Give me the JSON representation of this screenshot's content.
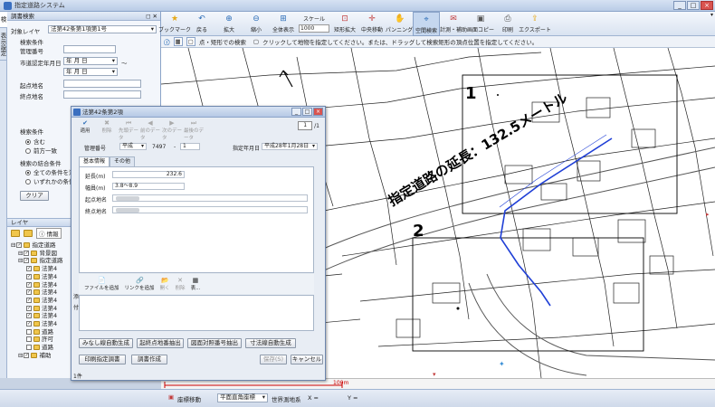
{
  "window": {
    "title": "指定道路システム",
    "controls": [
      "_",
      "□",
      "×"
    ]
  },
  "side_tabs": [
    "検索",
    "表示設定"
  ],
  "search_panel": {
    "header": "調書検索",
    "target_layer_label": "対象レイヤ",
    "target_layer_value": "法第42条第1項第1号",
    "search_conditions_label": "検索条件",
    "admin_no_label": "管理番号",
    "designation_date_label": "市道認定年月日",
    "year_month_day": "年 月 日",
    "range_separator": "～",
    "start_label": "起点地名",
    "end_label": "終点地名",
    "search_condition_group": "検索条件",
    "radio_includes": "含む",
    "radio_prefix": "前方一致",
    "combine_label": "検索の結合条件",
    "radio_all": "全ての条件を満たす",
    "radio_any": "いずれかの条件を満たす",
    "clear_button": "クリア"
  },
  "layer_panel": {
    "header": "レイヤ",
    "info_label": "情報",
    "tree": [
      {
        "label": "指定道路",
        "checked": true,
        "level": 0
      },
      {
        "label": "背景図",
        "checked": true,
        "level": 1
      },
      {
        "label": "指定道路",
        "checked": true,
        "level": 1
      },
      {
        "label": "法第4",
        "checked": true,
        "level": 2
      },
      {
        "label": "法第4",
        "checked": true,
        "level": 2
      },
      {
        "label": "法第4",
        "checked": true,
        "level": 2
      },
      {
        "label": "法第4",
        "checked": true,
        "level": 2
      },
      {
        "label": "法第4",
        "checked": true,
        "level": 2
      },
      {
        "label": "法第4",
        "checked": true,
        "level": 2
      },
      {
        "label": "法第4",
        "checked": true,
        "level": 2
      },
      {
        "label": "法第4",
        "checked": true,
        "level": 2
      },
      {
        "label": "道路",
        "checked": false,
        "level": 2
      },
      {
        "label": "許可",
        "checked": false,
        "level": 2
      },
      {
        "label": "道路",
        "checked": false,
        "level": 2
      },
      {
        "label": "補助",
        "checked": true,
        "level": 1
      }
    ]
  },
  "toolbar": {
    "items": [
      {
        "label": "ブックマーク",
        "icon": "star-icon",
        "glyph": "★",
        "color": "#e6a817"
      },
      {
        "label": "戻る",
        "icon": "undo-icon",
        "glyph": "↶",
        "color": "#2f6fb8"
      },
      {
        "label": "拡大",
        "icon": "zoom-in-icon",
        "glyph": "⊕",
        "color": "#2f6fb8"
      },
      {
        "label": "縮小",
        "icon": "zoom-out-icon",
        "glyph": "⊖",
        "color": "#2f6fb8"
      },
      {
        "label": "全体表示",
        "icon": "fit-icon",
        "glyph": "⊞",
        "color": "#2f6fb8"
      }
    ],
    "scale_label": "スケール",
    "scale_value": "1000",
    "items2": [
      {
        "label": "矩形拡大",
        "icon": "rect-zoom-icon",
        "glyph": "⊡",
        "color": "#c23b3b"
      },
      {
        "label": "中央移動",
        "icon": "center-move-icon",
        "glyph": "✛",
        "color": "#c23b3b"
      },
      {
        "label": "パンニング",
        "icon": "pan-icon",
        "glyph": "✋",
        "color": "#555555"
      },
      {
        "label": "空間検索",
        "icon": "spatial-search-icon",
        "glyph": "⌖",
        "color": "#2f6fb8",
        "selected": true
      },
      {
        "label": "計測・補助",
        "icon": "measure-icon",
        "glyph": "✉",
        "color": "#c23b3b"
      },
      {
        "label": "画面コピー",
        "icon": "screen-copy-icon",
        "glyph": "▣",
        "color": "#555555"
      },
      {
        "label": "印刷",
        "icon": "print-icon",
        "glyph": "⎙",
        "color": "#555555"
      },
      {
        "label": "エクスポート",
        "icon": "export-icon",
        "glyph": "⇪",
        "color": "#e6a817"
      }
    ]
  },
  "infobar": {
    "mode": "点・矩形での検索",
    "message": "クリックして地物を指定してください。または、ドラッグして検索矩形の頂点位置を指定してください。"
  },
  "map": {
    "label_1": "1",
    "label_2": "2",
    "road_length_label": "指定道路の延長：132.5メートル",
    "scale_text": "100m"
  },
  "dialog": {
    "title": "法第42条第2項",
    "controls": [
      "_",
      "□",
      "×"
    ],
    "tools": [
      {
        "label": "適用",
        "icon": "apply-icon",
        "glyph": "✔",
        "enabled": true
      },
      {
        "label": "削除",
        "icon": "delete-icon",
        "glyph": "✖",
        "enabled": false
      },
      {
        "label": "先頭データ",
        "icon": "first-icon",
        "glyph": "⏮",
        "enabled": false
      },
      {
        "label": "前のデータ",
        "icon": "prev-icon",
        "glyph": "◀",
        "enabled": false
      },
      {
        "label": "次のデータ",
        "icon": "next-icon",
        "glyph": "▶",
        "enabled": false
      },
      {
        "label": "最後のデータ",
        "icon": "last-icon",
        "glyph": "⏭",
        "enabled": false
      }
    ],
    "page_current": "1",
    "page_total": "/1",
    "admin_no_label": "管理番号",
    "era_value": "平成",
    "admin_no_value": "7497",
    "dash": "-",
    "admin_no_suffix": "1",
    "designation_date_label": "指定年月日",
    "designation_date_value": "平成28年1月28日",
    "tabs": [
      "基本情報",
      "その他"
    ],
    "fields": [
      {
        "label": "延長(m)",
        "value": "232.6"
      },
      {
        "label": "幅員(m)",
        "value": "3.8～8.9"
      },
      {
        "label": "起点地名",
        "value": ""
      },
      {
        "label": "終点地名",
        "value": ""
      }
    ],
    "bottom_tools": [
      {
        "label": "ファイルを追加",
        "icon": "add-file-icon",
        "glyph": "📄",
        "enabled": true
      },
      {
        "label": "リンクを追加",
        "icon": "add-link-icon",
        "glyph": "🔗",
        "enabled": true
      },
      {
        "label": "開く",
        "icon": "open-icon",
        "glyph": "📂",
        "enabled": false
      },
      {
        "label": "削除",
        "icon": "remove-icon",
        "glyph": "✕",
        "enabled": false
      },
      {
        "label": "表...",
        "icon": "table-icon",
        "glyph": "▦",
        "enabled": true
      }
    ],
    "side_labels": [
      "添",
      "付"
    ],
    "action_row1": [
      "みなし線自動生成",
      "起終点地番抽出",
      "図面対照番号抽出",
      "寸法線自動生成"
    ],
    "action_row2": [
      "印刷指定調書",
      "調書作成"
    ],
    "save_button": "保存(S)",
    "cancel_button": "キャンセル",
    "status": "1件"
  },
  "status_bar": {
    "coordinate_move": "座標移動",
    "coord_system": "平面直角座標",
    "datum": "世界測地系",
    "x_label": "X =",
    "y_label": "Y ="
  }
}
